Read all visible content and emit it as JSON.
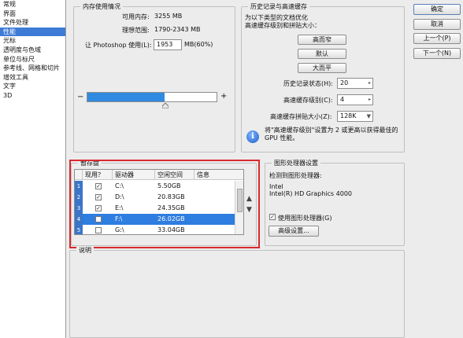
{
  "nav": {
    "items": [
      "常规",
      "界面",
      "文件处理",
      "性能",
      "光标",
      "透明度与色域",
      "单位与标尺",
      "参考线、网格和切片",
      "增效工具",
      "文字",
      "3D"
    ],
    "selected_index": 3
  },
  "memory": {
    "title": "内存使用情况",
    "available_label": "可用内存:",
    "available_value": "3255 MB",
    "ideal_label": "理想范围:",
    "ideal_value": "1790-2343 MB",
    "let_label": "让 Photoshop 使用(L):",
    "use_value": "1953",
    "use_unit": "MB(60%)",
    "minus": "−",
    "plus": "+",
    "slider_fraction": 0.6
  },
  "history": {
    "title": "历史记录与高速缓存",
    "desc_line1": "为以下类型的文档优化",
    "desc_line2": "高速缓存级别和拼贴大小：",
    "btn_tall_thin": "高而窄",
    "btn_default": "默认",
    "btn_big_flat": "大而平",
    "states_label": "历史记录状态(H):",
    "states_value": "20",
    "cache_levels_label": "高速缓存级别(C):",
    "cache_levels_value": "4",
    "tile_size_label": "高速缓存拼贴大小(Z):",
    "tile_size_value": "128K",
    "note_line1": "将\"高速缓存级别\"设置为 2 或更高以获得最佳的",
    "note_line2": "GPU 性能。"
  },
  "buttons": {
    "ok": "确定",
    "cancel": "取消",
    "prev": "上一个(P)",
    "next": "下一个(N)"
  },
  "scratch": {
    "title": "暂存盘",
    "headers": [
      "现用？",
      "驱动器",
      "空闲空间",
      "信息"
    ],
    "rows": [
      {
        "num": "1",
        "check": "✓",
        "drive": "C:\\",
        "free": "5.50GB",
        "selected": false
      },
      {
        "num": "2",
        "check": "✓",
        "drive": "D:\\",
        "free": "20.83GB",
        "selected": false
      },
      {
        "num": "3",
        "check": "✓",
        "drive": "E:\\",
        "free": "24.35GB",
        "selected": false
      },
      {
        "num": "4",
        "check": "",
        "drive": "F:\\",
        "free": "26.02GB",
        "selected": true
      },
      {
        "num": "5",
        "check": "",
        "drive": "G:\\",
        "free": "33.04GB",
        "selected": false
      }
    ],
    "up": "▲",
    "down": "▼"
  },
  "gpu": {
    "title": "图形处理器设置",
    "detected_label": "检测到图形处理器:",
    "vendor": "Intel",
    "model": "Intel(R) HD Graphics 4000",
    "use_gpu_label": "使用图形处理器(G)",
    "use_gpu_check": "✓",
    "advanced_button": "高级设置..."
  },
  "description": {
    "title": "说明"
  },
  "colors": {
    "selection": "#3d7bd6",
    "slider_fill": "#2f8ae0",
    "highlight_border": "#d9282d"
  }
}
